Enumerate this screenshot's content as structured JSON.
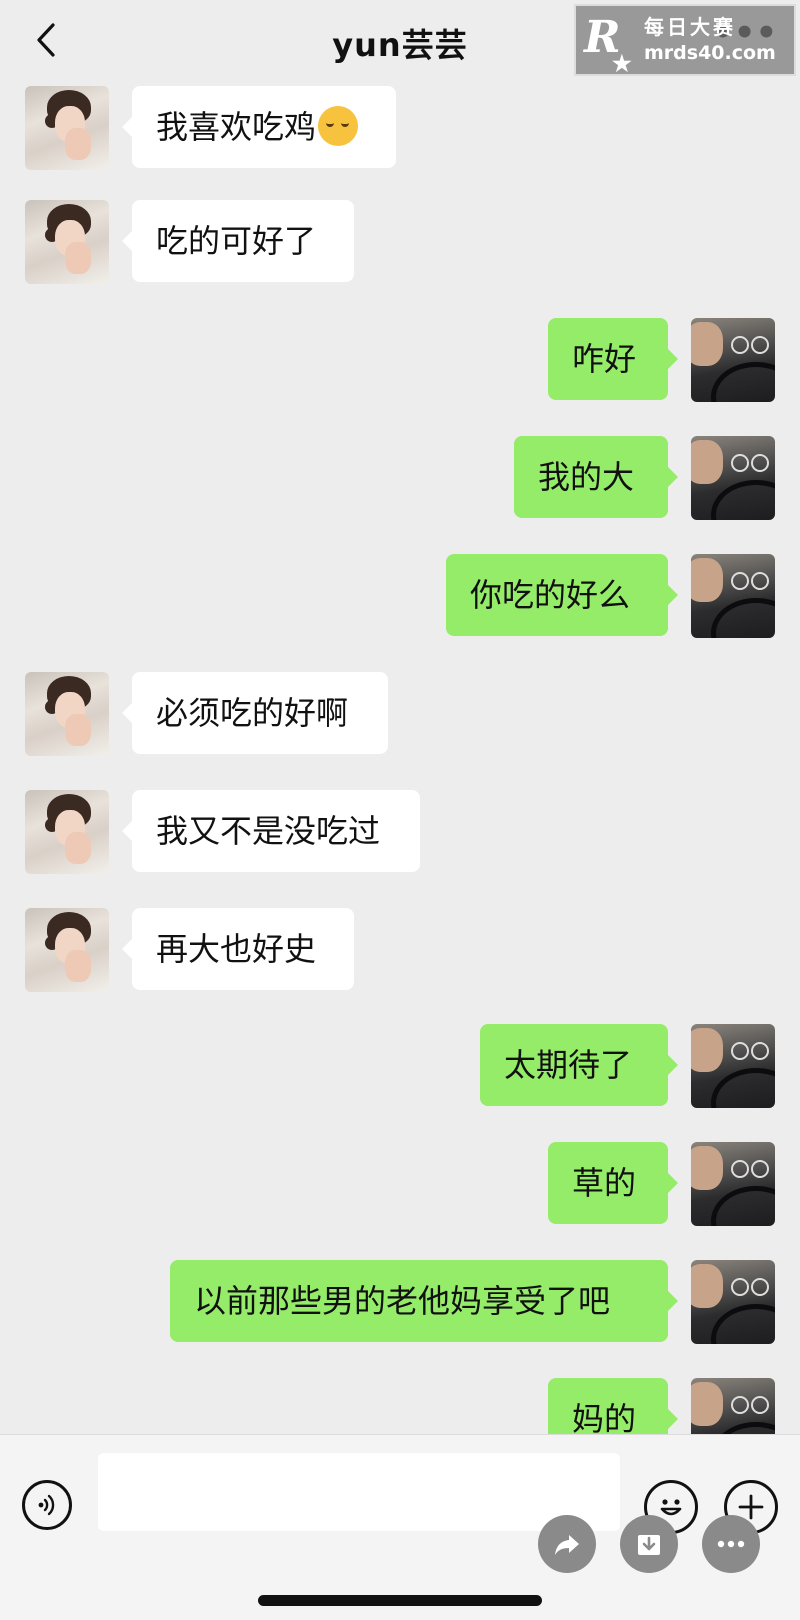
{
  "header": {
    "title": "yun芸芸",
    "back_icon": "chevron-left-icon",
    "more_label": "•••"
  },
  "watermark": {
    "logo": "R",
    "text_cn": "每日大赛",
    "url": "mrds40.com"
  },
  "messages": [
    {
      "side": "in",
      "text": "我喜欢吃鸡",
      "emoji": "smiling-face-emoji"
    },
    {
      "side": "in",
      "text": "吃的可好了"
    },
    {
      "side": "out",
      "text": "咋好"
    },
    {
      "side": "out",
      "text": "我的大"
    },
    {
      "side": "out",
      "text": "你吃的好么"
    },
    {
      "side": "in",
      "text": "必须吃的好啊"
    },
    {
      "side": "in",
      "text": "我又不是没吃过"
    },
    {
      "side": "in",
      "text": "再大也好史"
    },
    {
      "side": "out",
      "text": "太期待了"
    },
    {
      "side": "out",
      "text": "草的"
    },
    {
      "side": "out",
      "text": "以前那些男的老他妈享受了吧"
    },
    {
      "side": "out",
      "text": "妈的"
    }
  ],
  "input_bar": {
    "placeholder": "",
    "icons": [
      "voice-icon",
      "emoji-icon",
      "plus-icon"
    ],
    "actions": [
      "share-icon",
      "download-icon",
      "more-icon"
    ]
  },
  "colors": {
    "background": "#ededed",
    "incoming_bubble": "#ffffff",
    "outgoing_bubble": "#95ec69"
  }
}
